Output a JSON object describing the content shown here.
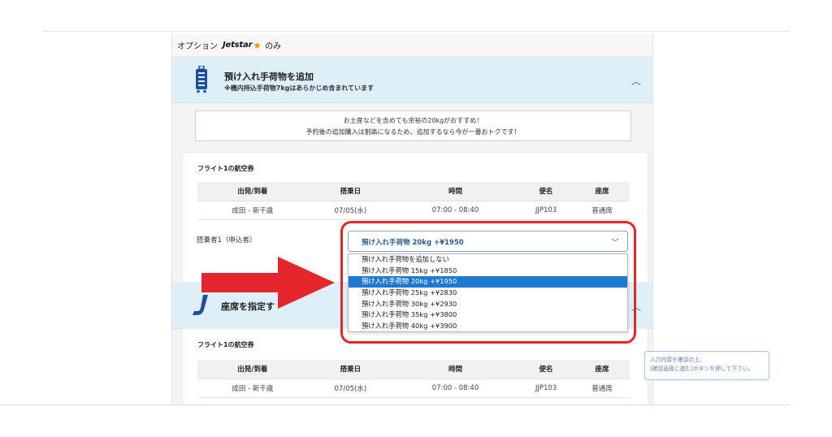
{
  "option_bar": {
    "prefix": "オプション",
    "brand": "Jetstar",
    "suffix": "のみ"
  },
  "baggage_section": {
    "title": "預け入れ手荷物を追加",
    "subtitle": "※機内持込手荷物7kgはあらかじめ含まれています",
    "icon": "luggage-icon"
  },
  "notice": {
    "line1": "お土産などを含めても余裕の20kgがおすすめ！",
    "line2": "予約後の追加購入は割高になるため、追加するなら今が一番おトクです！"
  },
  "flight1": {
    "title": "フライト1の航空券",
    "headers": [
      "出発/到着",
      "搭乗日",
      "時間",
      "便名",
      "座席"
    ],
    "row": [
      "成田 - 新千歳",
      "07/05(水)",
      "07:00 - 08:40",
      "JJP103",
      "普通席"
    ]
  },
  "passenger": {
    "label": "搭乗者1（申込者）"
  },
  "baggage_select": {
    "selected": "預け入れ手荷物 20kg +¥1950",
    "options": [
      "預け入れ手荷物を追加しない",
      "預け入れ手荷物 15kg +¥1850",
      "預け入れ手荷物 20kg +¥1950",
      "預け入れ手荷物 25kg +¥2830",
      "預け入れ手荷物 30kg +¥2930",
      "預け入れ手荷物 35kg +¥3800",
      "預け入れ手荷物 40kg +¥3900"
    ],
    "selected_index": 2
  },
  "seat_section": {
    "title": "座席を指定す",
    "icon": "jetstar-j-icon"
  },
  "flight2": {
    "title": "フライト1の航空券",
    "headers": [
      "出発/到着",
      "搭乗日",
      "時間",
      "便名",
      "座席"
    ],
    "row": [
      "成田 - 新千歳",
      "07/05(水)",
      "07:00 - 08:40",
      "JJP103",
      "普通席"
    ]
  },
  "hint": {
    "line1": "入力内容を確認の上、",
    "line2": "[確認画面に進む]ボタンを押して下さい。"
  },
  "colors": {
    "accent_blue": "#1f78d1",
    "highlight_red": "#e5262d",
    "section_bg": "#dfeff8"
  }
}
